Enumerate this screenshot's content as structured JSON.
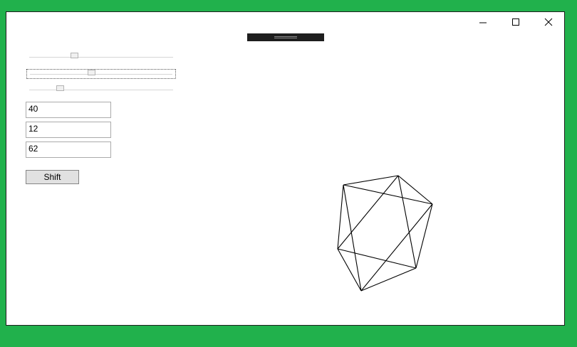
{
  "window": {
    "caption_buttons": {
      "minimize": "minimize-icon",
      "maximize": "maximize-icon",
      "close": "close-icon"
    }
  },
  "controls": {
    "sliders": [
      {
        "name": "slider-1",
        "level": 0.31
      },
      {
        "name": "slider-2",
        "level": 0.43
      },
      {
        "name": "slider-3",
        "level": 0.21
      }
    ],
    "inputs": [
      {
        "name": "value-input-1",
        "value": "40"
      },
      {
        "name": "value-input-2",
        "value": "12"
      },
      {
        "name": "value-input-3",
        "value": "62"
      }
    ],
    "shift_label": "Shift"
  },
  "colors": {
    "background": "#21b14c",
    "window": "#ffffff",
    "handle": "#1e1e1e",
    "line": "#000000"
  }
}
